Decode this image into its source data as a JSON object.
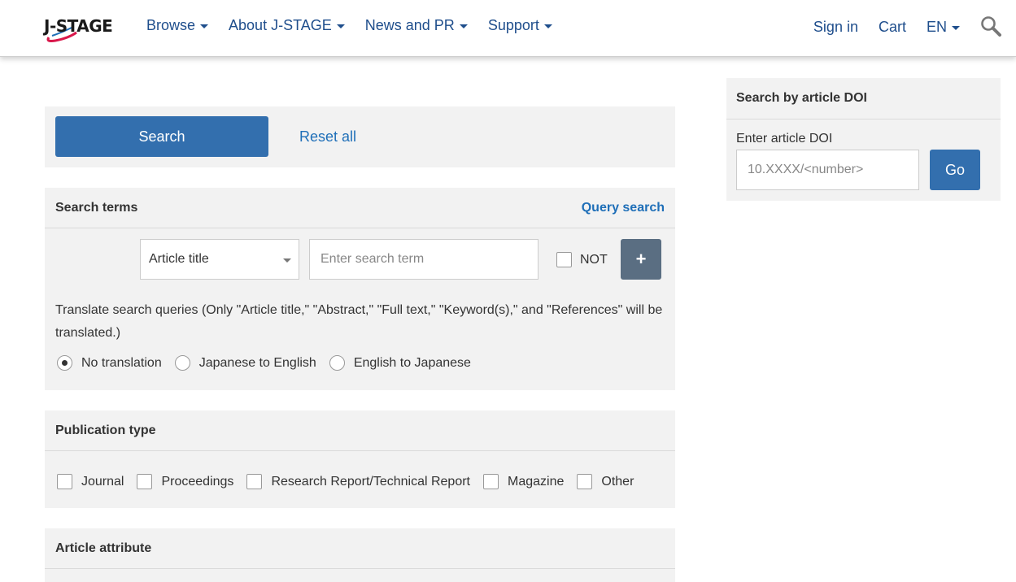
{
  "header": {
    "logo_text": "J-STAGE",
    "nav": [
      {
        "label": "Browse"
      },
      {
        "label": "About J-STAGE"
      },
      {
        "label": "News and PR"
      },
      {
        "label": "Support"
      }
    ],
    "right": {
      "sign_in": "Sign in",
      "cart": "Cart",
      "language": "EN"
    }
  },
  "actions": {
    "search_label": "Search",
    "reset_label": "Reset all"
  },
  "search_terms": {
    "title": "Search terms",
    "query_search": "Query search",
    "field_select": "Article title",
    "term_placeholder": "Enter search term",
    "not_label": "NOT",
    "add_label": "+",
    "translate_note": "Translate search queries (Only \"Article title,\" \"Abstract,\" \"Full text,\" \"Keyword(s),\" and \"References\" will be translated.)",
    "translation_options": [
      {
        "label": "No translation",
        "selected": true
      },
      {
        "label": "Japanese to English",
        "selected": false
      },
      {
        "label": "English to Japanese",
        "selected": false
      }
    ]
  },
  "publication_type": {
    "title": "Publication type",
    "options": [
      "Journal",
      "Proceedings",
      "Research Report/Technical Report",
      "Magazine",
      "Other"
    ]
  },
  "article_attribute": {
    "title": "Article attribute"
  },
  "doi": {
    "title": "Search by article DOI",
    "label": "Enter article DOI",
    "placeholder": "10.XXXX/<number>",
    "go_label": "Go"
  },
  "colors": {
    "primary": "#336fae",
    "link": "#1f6fb8",
    "nav_text": "#1f4e8c",
    "panel_bg": "#f2f2f2",
    "plus_button": "#5a6e82"
  }
}
